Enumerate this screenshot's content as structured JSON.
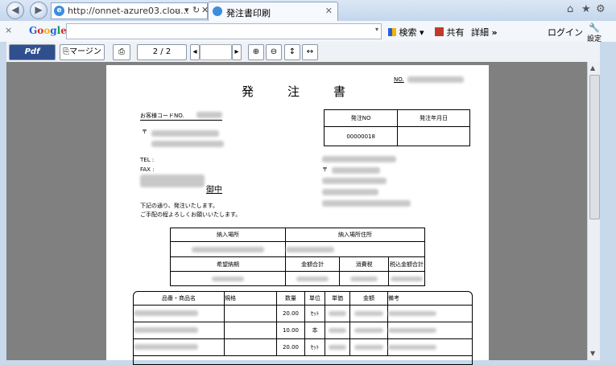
{
  "browser": {
    "url": "http://onnet-azure03.clou...",
    "address_controls": [
      "⌕",
      "▾",
      "↻",
      "✕"
    ],
    "tab_title": "発注書印刷",
    "tab_close": "✕",
    "right_icons": [
      "⌂",
      "★",
      "⚙"
    ]
  },
  "google_bar": {
    "close": "×",
    "logo": "Google",
    "search_label": "検索",
    "share_label": "共有",
    "details_label": "詳細",
    "more": "»",
    "login": "ログイン",
    "settings": "設定"
  },
  "pdf_toolbar": {
    "logo": "Pdf",
    "margin_label": "マージン",
    "page_indicator": "2 / 2",
    "prev": "◂",
    "next": "▸"
  },
  "document": {
    "title": "発　　注　　書",
    "no_label": "NO.",
    "customer_code_label": "お客様コードNO.",
    "postal_mark": "〒",
    "tel_label": "TEL :",
    "fax_label": "FAX :",
    "honorific": "御中",
    "intro_line1": "下記の通り、発注いたします。",
    "intro_line2": "ご手配の程よろしくお願いいたします。",
    "order_box": {
      "header1": "発注NO",
      "header2": "発注年月日",
      "order_no": "00000018",
      "order_date": ""
    },
    "delivery": {
      "place_header": "納入場所",
      "address_header": "納入場所住所",
      "due_header": "希望納期",
      "amount_header": "金額合計",
      "tax_header": "消費税",
      "total_header": "税込金額合計"
    },
    "items": {
      "headers": [
        "品番・商品名",
        "規格",
        "数量",
        "単位",
        "単価",
        "金額",
        "備考"
      ],
      "rows": [
        {
          "qty": "20.00",
          "unit": "ｾｯﾄ"
        },
        {
          "qty": "10.00",
          "unit": "本"
        },
        {
          "qty": "20.00",
          "unit": "ｾｯﾄ"
        }
      ]
    }
  }
}
